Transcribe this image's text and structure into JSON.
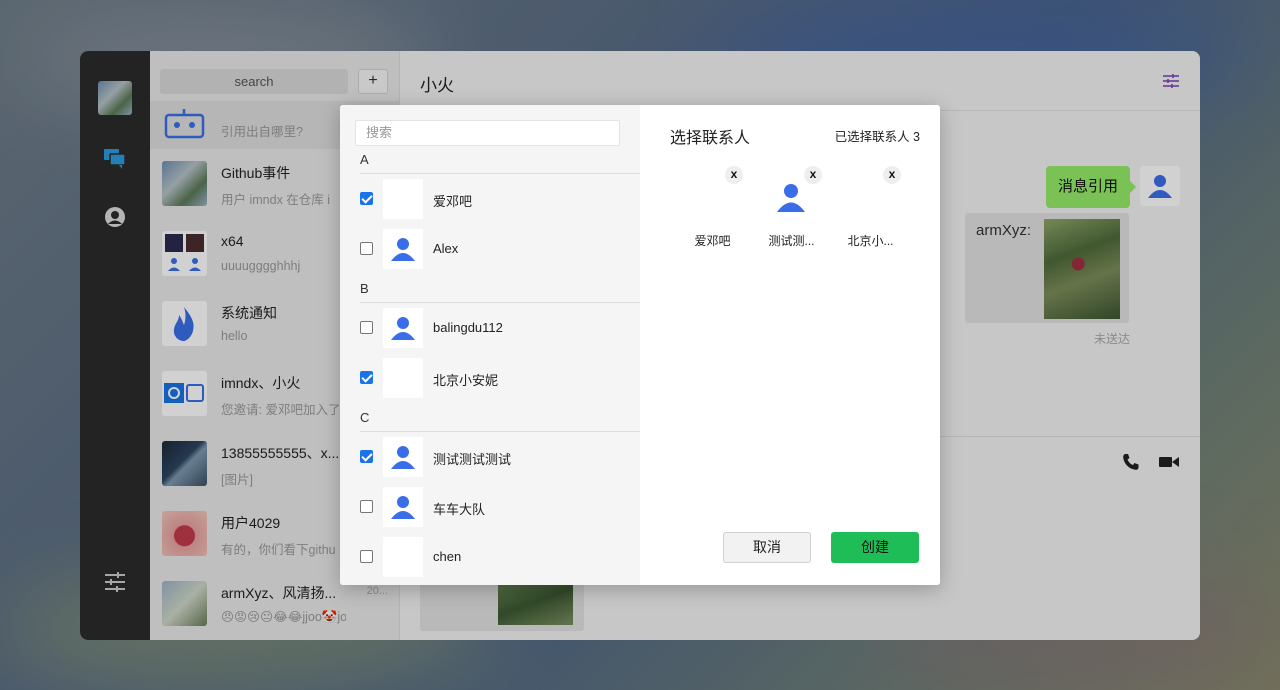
{
  "sidebar": {
    "icons": [
      "user-avatar",
      "chat-icon",
      "contacts-icon",
      "settings-icon"
    ]
  },
  "list": {
    "search_placeholder": "search",
    "add_label": "+",
    "conversations": [
      {
        "name": "",
        "message": "引用出自哪里?",
        "time": ""
      },
      {
        "name": "Github事件",
        "message": "用户 imndx 在仓库 i",
        "time": ""
      },
      {
        "name": "x64",
        "message": "uuuugggghhhj",
        "time": ""
      },
      {
        "name": "系统通知",
        "message": "hello",
        "time": ""
      },
      {
        "name": "imndx、小火",
        "message": "您邀请: 爱邓吧加入了",
        "time": ""
      },
      {
        "name": "13855555555、x...",
        "message": "[图片]",
        "time": ""
      },
      {
        "name": "用户4029",
        "message": "有的，你们看下githu",
        "time": "20"
      },
      {
        "name": "armXyz、风清扬...",
        "message": "😠😡😢😐😂😂jjoo🤡jo",
        "time": "20..."
      }
    ]
  },
  "chat": {
    "title": "小火",
    "bubble": "消息引用",
    "quote_name": "armXyz:",
    "status": "未送达"
  },
  "modal": {
    "search_placeholder": "搜索",
    "groups": [
      {
        "letter": "A",
        "contacts": [
          {
            "name": "爱邓吧",
            "checked": true
          },
          {
            "name": "Alex",
            "checked": false
          }
        ]
      },
      {
        "letter": "B",
        "contacts": [
          {
            "name": "balingdu112",
            "checked": false
          },
          {
            "name": "北京小安妮",
            "checked": true
          }
        ]
      },
      {
        "letter": "C",
        "contacts": [
          {
            "name": "测试测试测试",
            "checked": true
          },
          {
            "name": "车车大队",
            "checked": false
          },
          {
            "name": "chen",
            "checked": false
          }
        ]
      }
    ],
    "title": "选择联系人",
    "selected_count": "已选择联系人 3",
    "selected": [
      {
        "label": "爱邓吧",
        "remove": "x"
      },
      {
        "label": "测试测...",
        "remove": "x"
      },
      {
        "label": "北京小...",
        "remove": "x"
      }
    ],
    "cancel_label": "取消",
    "create_label": "创建"
  },
  "colors": {
    "accent_green": "#1fbd58",
    "bubble_green": "#95ec69",
    "avatar_blue": "#3a6ee8",
    "checkbox_blue": "#1a73e8"
  }
}
